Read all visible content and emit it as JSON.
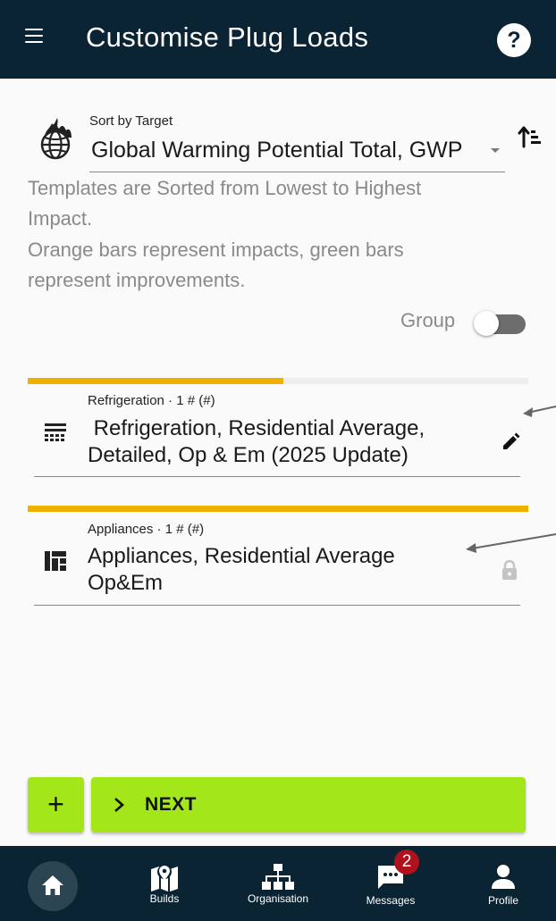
{
  "header": {
    "title": "Customise Plug Loads",
    "help_label": "?"
  },
  "sort": {
    "label": "Sort by Target",
    "value": "Global Warming Potential Total, GWP",
    "icon": "globe-fire-icon",
    "order_icon": "sort-ascending-icon"
  },
  "help_text": {
    "line1": "Templates are Sorted from Lowest to Highest",
    "line2": "Impact.",
    "line3": "Orange bars represent impacts, green bars",
    "line4": "represent improvements."
  },
  "group_toggle": {
    "label": "Group",
    "on": false
  },
  "items": [
    {
      "subtitle": "Refrigeration · 1 # (#)",
      "title_line1": " Refrigeration, Residential Average,",
      "title_line2": "Detailed, Op & Em (2025 Update)",
      "icon": "refrigeration-icon",
      "action_icon": "edit-pencil-icon",
      "impact_fraction": 0.51,
      "impact_color": "#f0b000"
    },
    {
      "subtitle": "Appliances · 1 # (#)",
      "title_line1": "Appliances, Residential Average",
      "title_line2": "Op&Em",
      "icon": "appliances-icon",
      "action_icon": "lock-icon",
      "impact_fraction": 1.0,
      "impact_color": "#f0b000"
    }
  ],
  "actions": {
    "add_label": "+",
    "next_label": "NEXT"
  },
  "bottom_nav": {
    "home": {
      "label": "",
      "icon": "home-icon"
    },
    "builds": {
      "label": "Builds",
      "icon": "map-icon"
    },
    "organisation": {
      "label": "Organisation",
      "icon": "org-chart-icon"
    },
    "messages": {
      "label": "Messages",
      "icon": "chat-icon",
      "badge": "2"
    },
    "profile": {
      "label": "Profile",
      "icon": "person-icon"
    }
  },
  "colors": {
    "header_bg": "#0b2434",
    "accent_green": "#a3e619",
    "impact_orange": "#f0b000",
    "badge_red": "#b0121d"
  }
}
